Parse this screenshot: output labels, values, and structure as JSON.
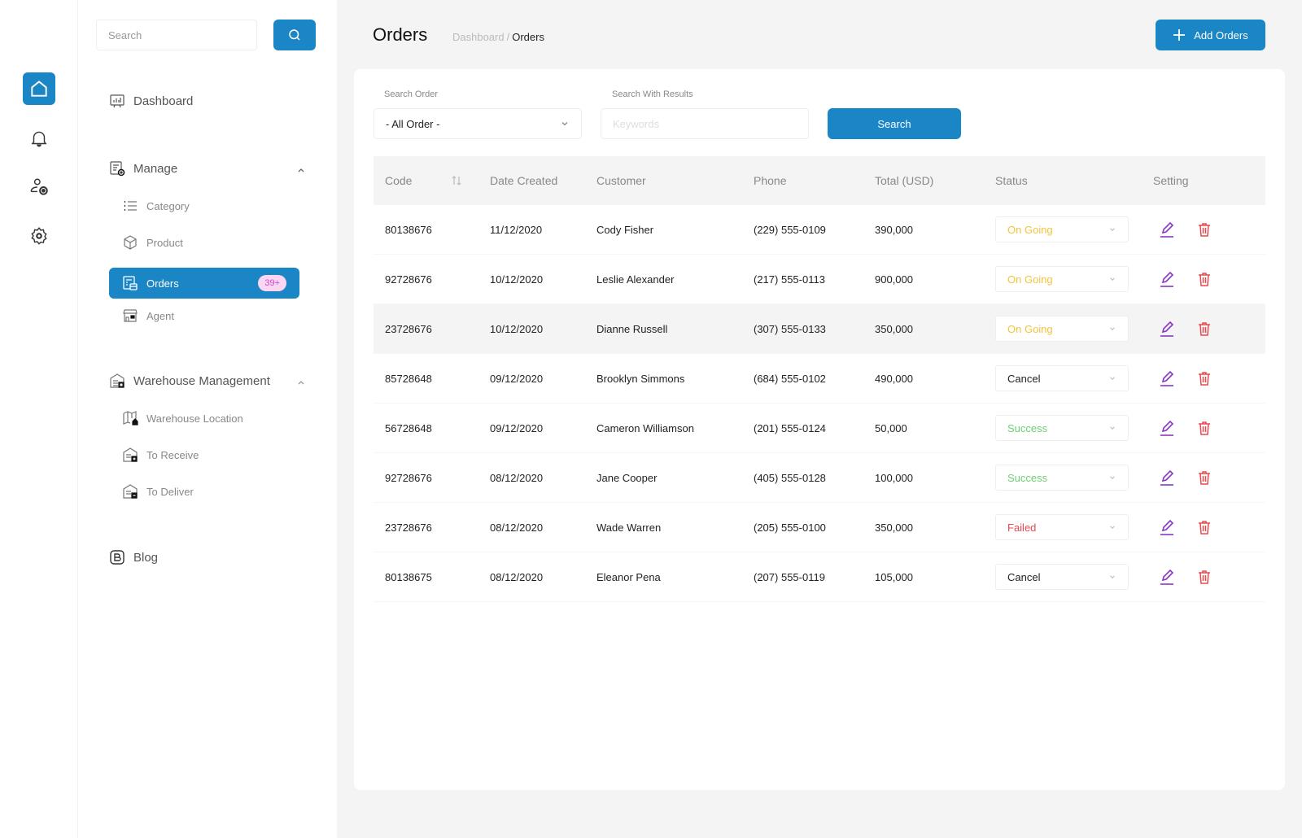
{
  "rail": {
    "items": [
      "home-icon",
      "bell-icon",
      "user-settings-icon",
      "gear-icon"
    ]
  },
  "sidebar": {
    "search_placeholder": "Search",
    "dashboard": "Dashboard",
    "manage": {
      "label": "Manage",
      "items": [
        {
          "label": "Category",
          "icon": "list-icon"
        },
        {
          "label": "Product",
          "icon": "box-icon"
        },
        {
          "label": "Orders",
          "icon": "orders-icon",
          "badge": "39+",
          "active": true
        },
        {
          "label": "Agent",
          "icon": "store-icon"
        }
      ]
    },
    "warehouse": {
      "label": "Warehouse Management",
      "items": [
        {
          "label": "Warehouse Location",
          "icon": "map-icon"
        },
        {
          "label": "To Receive",
          "icon": "warehouse-in-icon"
        },
        {
          "label": "To Deliver",
          "icon": "warehouse-out-icon"
        }
      ]
    },
    "blog": "Blog"
  },
  "header": {
    "title": "Orders",
    "breadcrumb": [
      "Dashboard",
      "/",
      "Orders"
    ],
    "add_button": "Add Orders"
  },
  "filters": {
    "search_order_label": "Search Order",
    "search_order_value": "- All Order -",
    "search_results_label": "Search With Results",
    "keywords_placeholder": "Keywords",
    "search_button": "Search"
  },
  "table": {
    "columns": [
      "Code",
      "Date Created",
      "Customer",
      "Phone",
      "Total (USD)",
      "Status",
      "Setting"
    ],
    "rows": [
      {
        "code": "80138676",
        "date": "11/12/2020",
        "customer": "Cody Fisher",
        "phone": "(229) 555-0109",
        "total": "390,000",
        "status": "On Going"
      },
      {
        "code": "92728676",
        "date": "10/12/2020",
        "customer": "Leslie Alexander",
        "phone": "(217) 555-0113",
        "total": "900,000",
        "status": "On Going"
      },
      {
        "code": "23728676",
        "date": "10/12/2020",
        "customer": "Dianne Russell",
        "phone": "(307) 555-0133",
        "total": "350,000",
        "status": "On Going"
      },
      {
        "code": "85728648",
        "date": "09/12/2020",
        "customer": "Brooklyn Simmons",
        "phone": "(684) 555-0102",
        "total": "490,000",
        "status": "Cancel"
      },
      {
        "code": "56728648",
        "date": "09/12/2020",
        "customer": "Cameron Williamson",
        "phone": "(201) 555-0124",
        "total": "50,000",
        "status": "Success"
      },
      {
        "code": "92728676",
        "date": "08/12/2020",
        "customer": "Jane Cooper",
        "phone": "(405) 555-0128",
        "total": "100,000",
        "status": "Success"
      },
      {
        "code": "23728676",
        "date": "08/12/2020",
        "customer": "Wade Warren",
        "phone": "(205) 555-0100",
        "total": "350,000",
        "status": "Failed"
      },
      {
        "code": "80138675",
        "date": "08/12/2020",
        "customer": "Eleanor Pena",
        "phone": "(207) 555-0119",
        "total": "105,000",
        "status": "Cancel"
      }
    ]
  },
  "colors": {
    "primary": "#1b86c6",
    "on_going": "#f3c43c",
    "success": "#6fcf72",
    "failed": "#e5484d",
    "cancel": "#222222",
    "edit": "#8a35c9",
    "delete": "#e5484d",
    "badge_bg": "#fbd6f3",
    "badge_text": "#d14ad1"
  }
}
